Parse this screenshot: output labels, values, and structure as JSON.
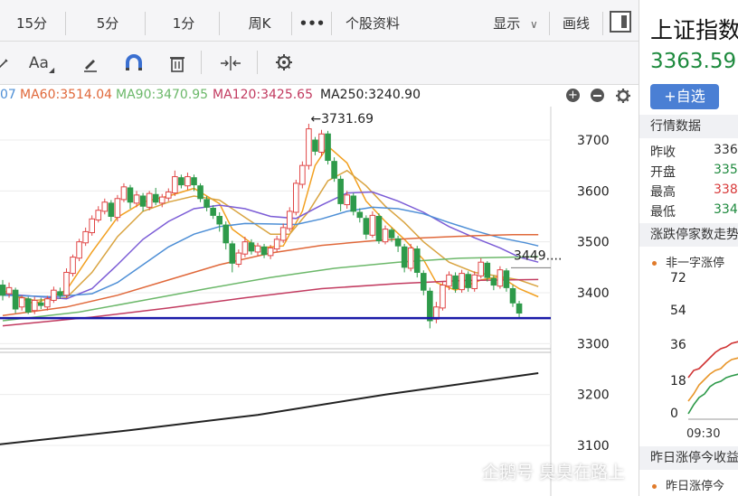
{
  "period_tabs": [
    "15分",
    "5分",
    "1分",
    "周K",
    "•••",
    "个股资料"
  ],
  "top_right": {
    "display_label": "显示",
    "draw_label": "画线"
  },
  "tools": {
    "font_label": "Aa"
  },
  "ma_legend": [
    {
      "label": "07",
      "color": "#4e8fd6"
    },
    {
      "label": "MA60:3514.04",
      "color": "#e0683a"
    },
    {
      "label": "MA90:3470.95",
      "color": "#6cb86a"
    },
    {
      "label": "MA120:3425.65",
      "color": "#c23b60"
    },
    {
      "label": "MA250:3240.90",
      "color": "#222222"
    }
  ],
  "chart_data": {
    "type": "candlestick",
    "y_ticks": [
      "3700",
      "3600",
      "3500",
      "3400",
      "3300",
      "3200",
      "3100"
    ],
    "ylim": [
      3100,
      3730
    ],
    "high_label": "3731.69",
    "right_label": "3449....",
    "support_level": 3350,
    "candles": [
      [
        3415,
        3395,
        3425,
        3385
      ],
      [
        3398,
        3410,
        3420,
        3390
      ],
      [
        3405,
        3368,
        3410,
        3360
      ],
      [
        3372,
        3390,
        3395,
        3365
      ],
      [
        3388,
        3362,
        3392,
        3358
      ],
      [
        3365,
        3385,
        3392,
        3358
      ],
      [
        3380,
        3375,
        3390,
        3368
      ],
      [
        3372,
        3388,
        3394,
        3365
      ],
      [
        3385,
        3405,
        3412,
        3380
      ],
      [
        3402,
        3395,
        3410,
        3388
      ],
      [
        3395,
        3440,
        3448,
        3390
      ],
      [
        3438,
        3470,
        3475,
        3432
      ],
      [
        3468,
        3500,
        3506,
        3462
      ],
      [
        3498,
        3520,
        3528,
        3492
      ],
      [
        3518,
        3545,
        3552,
        3512
      ],
      [
        3543,
        3562,
        3570,
        3538
      ],
      [
        3560,
        3578,
        3585,
        3554
      ],
      [
        3576,
        3550,
        3582,
        3540
      ],
      [
        3548,
        3585,
        3592,
        3540
      ],
      [
        3583,
        3608,
        3615,
        3578
      ],
      [
        3606,
        3578,
        3612,
        3565
      ],
      [
        3576,
        3592,
        3600,
        3568
      ],
      [
        3590,
        3570,
        3596,
        3560
      ],
      [
        3568,
        3595,
        3600,
        3562
      ],
      [
        3593,
        3578,
        3606,
        3572
      ],
      [
        3576,
        3588,
        3594,
        3568
      ],
      [
        3586,
        3598,
        3605,
        3580
      ],
      [
        3596,
        3628,
        3640,
        3590
      ],
      [
        3626,
        3612,
        3632,
        3605
      ],
      [
        3610,
        3628,
        3636,
        3602
      ],
      [
        3626,
        3612,
        3632,
        3600
      ],
      [
        3610,
        3585,
        3615,
        3578
      ],
      [
        3583,
        3568,
        3590,
        3560
      ],
      [
        3566,
        3552,
        3572,
        3545
      ],
      [
        3550,
        3535,
        3558,
        3520
      ],
      [
        3533,
        3498,
        3540,
        3485
      ],
      [
        3496,
        3458,
        3502,
        3440
      ],
      [
        3456,
        3478,
        3485,
        3450
      ],
      [
        3476,
        3500,
        3510,
        3470
      ],
      [
        3498,
        3482,
        3505,
        3475
      ],
      [
        3480,
        3492,
        3498,
        3472
      ],
      [
        3490,
        3475,
        3496,
        3468
      ],
      [
        3473,
        3488,
        3494,
        3466
      ],
      [
        3486,
        3505,
        3512,
        3480
      ],
      [
        3503,
        3528,
        3536,
        3498
      ],
      [
        3526,
        3560,
        3568,
        3520
      ],
      [
        3558,
        3615,
        3622,
        3552
      ],
      [
        3613,
        3650,
        3658,
        3605
      ],
      [
        3650,
        3722,
        3732,
        3642
      ],
      [
        3700,
        3678,
        3706,
        3670
      ],
      [
        3676,
        3712,
        3720,
        3668
      ],
      [
        3712,
        3660,
        3718,
        3652
      ],
      [
        3658,
        3625,
        3666,
        3618
      ],
      [
        3623,
        3575,
        3630,
        3560
      ],
      [
        3573,
        3592,
        3600,
        3565
      ],
      [
        3590,
        3560,
        3596,
        3552
      ],
      [
        3558,
        3548,
        3566,
        3538
      ],
      [
        3546,
        3515,
        3552,
        3505
      ],
      [
        3513,
        3552,
        3560,
        3508
      ],
      [
        3550,
        3502,
        3556,
        3496
      ],
      [
        3500,
        3525,
        3532,
        3495
      ],
      [
        3523,
        3508,
        3528,
        3500
      ],
      [
        3506,
        3492,
        3512,
        3480
      ],
      [
        3490,
        3450,
        3496,
        3440
      ],
      [
        3448,
        3488,
        3496,
        3442
      ],
      [
        3486,
        3440,
        3492,
        3430
      ],
      [
        3438,
        3405,
        3444,
        3395
      ],
      [
        3403,
        3345,
        3410,
        3330
      ],
      [
        3348,
        3372,
        3382,
        3340
      ],
      [
        3370,
        3415,
        3422,
        3365
      ],
      [
        3413,
        3435,
        3442,
        3405
      ],
      [
        3433,
        3408,
        3440,
        3400
      ],
      [
        3406,
        3438,
        3445,
        3400
      ],
      [
        3436,
        3410,
        3442,
        3402
      ],
      [
        3408,
        3435,
        3442,
        3402
      ],
      [
        3433,
        3460,
        3468,
        3428
      ],
      [
        3458,
        3430,
        3462,
        3422
      ],
      [
        3428,
        3415,
        3434,
        3405
      ],
      [
        3413,
        3445,
        3452,
        3408
      ],
      [
        3443,
        3410,
        3448,
        3402
      ],
      [
        3408,
        3380,
        3415,
        3372
      ],
      [
        3378,
        3360,
        3384,
        3352
      ]
    ],
    "ma_lines": [
      {
        "name": "MA5",
        "color": "#f2a020",
        "values": [
          [
            0,
            3405
          ],
          [
            5,
            3378
          ],
          [
            10,
            3405
          ],
          [
            14,
            3480
          ],
          [
            18,
            3548
          ],
          [
            22,
            3578
          ],
          [
            26,
            3590
          ],
          [
            30,
            3605
          ],
          [
            34,
            3575
          ],
          [
            36,
            3525
          ],
          [
            40,
            3488
          ],
          [
            44,
            3492
          ],
          [
            47,
            3560
          ],
          [
            49,
            3650
          ],
          [
            51,
            3688
          ],
          [
            54,
            3655
          ],
          [
            57,
            3580
          ],
          [
            60,
            3540
          ],
          [
            63,
            3505
          ],
          [
            66,
            3465
          ],
          [
            68,
            3420
          ],
          [
            71,
            3405
          ],
          [
            75,
            3425
          ],
          [
            78,
            3432
          ],
          [
            81,
            3408
          ],
          [
            84,
            3392
          ]
        ]
      },
      {
        "name": "MA10",
        "color": "#d9a441",
        "values": [
          [
            0,
            3400
          ],
          [
            5,
            3385
          ],
          [
            10,
            3390
          ],
          [
            14,
            3440
          ],
          [
            18,
            3510
          ],
          [
            22,
            3560
          ],
          [
            26,
            3578
          ],
          [
            30,
            3590
          ],
          [
            34,
            3582
          ],
          [
            38,
            3548
          ],
          [
            42,
            3515
          ],
          [
            45,
            3515
          ],
          [
            48,
            3560
          ],
          [
            51,
            3620
          ],
          [
            54,
            3640
          ],
          [
            57,
            3610
          ],
          [
            60,
            3570
          ],
          [
            63,
            3538
          ],
          [
            66,
            3500
          ],
          [
            70,
            3460
          ],
          [
            74,
            3440
          ],
          [
            78,
            3432
          ],
          [
            81,
            3425
          ],
          [
            84,
            3412
          ]
        ]
      },
      {
        "name": "MA20",
        "color": "#7b5cd6",
        "values": [
          [
            0,
            3398
          ],
          [
            6,
            3392
          ],
          [
            10,
            3388
          ],
          [
            14,
            3408
          ],
          [
            18,
            3455
          ],
          [
            22,
            3505
          ],
          [
            26,
            3540
          ],
          [
            30,
            3565
          ],
          [
            34,
            3572
          ],
          [
            38,
            3565
          ],
          [
            42,
            3550
          ],
          [
            46,
            3546
          ],
          [
            50,
            3572
          ],
          [
            54,
            3596
          ],
          [
            58,
            3598
          ],
          [
            62,
            3580
          ],
          [
            66,
            3558
          ],
          [
            70,
            3530
          ],
          [
            74,
            3508
          ],
          [
            78,
            3488
          ],
          [
            81,
            3470
          ],
          [
            84,
            3460
          ]
        ]
      },
      {
        "name": "MA30",
        "color": "#4e8fd6",
        "values": [
          [
            0,
            3395
          ],
          [
            8,
            3392
          ],
          [
            14,
            3398
          ],
          [
            18,
            3420
          ],
          [
            22,
            3455
          ],
          [
            26,
            3490
          ],
          [
            30,
            3515
          ],
          [
            34,
            3530
          ],
          [
            38,
            3536
          ],
          [
            42,
            3535
          ],
          [
            46,
            3534
          ],
          [
            50,
            3545
          ],
          [
            54,
            3560
          ],
          [
            58,
            3568
          ],
          [
            62,
            3565
          ],
          [
            66,
            3555
          ],
          [
            70,
            3538
          ],
          [
            74,
            3522
          ],
          [
            78,
            3508
          ],
          [
            82,
            3498
          ],
          [
            84,
            3492
          ]
        ]
      },
      {
        "name": "MA60",
        "color": "#e0683a",
        "values": [
          [
            0,
            3355
          ],
          [
            10,
            3372
          ],
          [
            18,
            3395
          ],
          [
            26,
            3425
          ],
          [
            34,
            3455
          ],
          [
            42,
            3478
          ],
          [
            50,
            3493
          ],
          [
            58,
            3502
          ],
          [
            66,
            3508
          ],
          [
            74,
            3512
          ],
          [
            80,
            3514
          ],
          [
            84,
            3514
          ]
        ]
      },
      {
        "name": "MA90",
        "color": "#6cb86a",
        "values": [
          [
            0,
            3345
          ],
          [
            12,
            3362
          ],
          [
            22,
            3385
          ],
          [
            32,
            3408
          ],
          [
            42,
            3430
          ],
          [
            52,
            3448
          ],
          [
            62,
            3460
          ],
          [
            72,
            3468
          ],
          [
            80,
            3470
          ],
          [
            84,
            3471
          ]
        ]
      },
      {
        "name": "MA120",
        "color": "#c23b60",
        "values": [
          [
            0,
            3335
          ],
          [
            14,
            3352
          ],
          [
            26,
            3370
          ],
          [
            38,
            3390
          ],
          [
            50,
            3408
          ],
          [
            62,
            3418
          ],
          [
            72,
            3424
          ],
          [
            84,
            3426
          ]
        ]
      },
      {
        "name": "MA250",
        "color": "#222222",
        "values": [
          [
            -2,
            3100
          ],
          [
            20,
            3130
          ],
          [
            40,
            3160
          ],
          [
            60,
            3200
          ],
          [
            84,
            3242
          ]
        ]
      }
    ]
  },
  "right_panel": {
    "title": "上证指数",
    "price": "3363.59",
    "add_label": "+自选",
    "market_header": "行情数据",
    "rows": [
      {
        "key": "昨收",
        "value": "336",
        "color": "#333333"
      },
      {
        "key": "开盘",
        "value": "335",
        "color": "#1e8a3e"
      },
      {
        "key": "最高",
        "value": "338",
        "color": "#d83a3a"
      },
      {
        "key": "最低",
        "value": "334",
        "color": "#1e8a3e"
      }
    ],
    "limit_header": "涨跌停家数走势",
    "limit_legend": "非一字涨停",
    "limit_ticks": [
      "72",
      "54",
      "36",
      "18",
      "0"
    ],
    "limit_time": "09:30",
    "yesterday_header": "昨日涨停今收益",
    "yesterday_item": "昨日涨停今"
  },
  "watermark": "企鹅号 臭臭在路上"
}
